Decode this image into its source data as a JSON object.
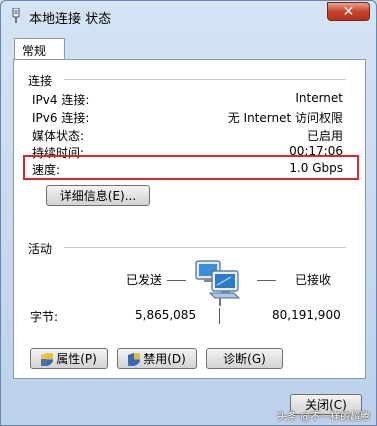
{
  "window": {
    "title": "本地连接 状态",
    "close_glyph": "✕"
  },
  "tabs": [
    {
      "label": "常规"
    }
  ],
  "connection": {
    "heading": "连接",
    "rows": [
      {
        "label": "IPv4 连接:",
        "value": "Internet"
      },
      {
        "label": "IPv6 连接:",
        "value": "无 Internet 访问权限"
      },
      {
        "label": "媒体状态:",
        "value": "已启用"
      },
      {
        "label": "持续时间:",
        "value": "00:17:06"
      },
      {
        "label": "速度:",
        "value": "1.0 Gbps"
      }
    ],
    "details_button": "详细信息(E)..."
  },
  "activity": {
    "heading": "活动",
    "sent_label": "已发送",
    "received_label": "已接收",
    "bytes_label": "字节:",
    "bytes_sent": "5,865,085",
    "bytes_received": "80,191,900"
  },
  "buttons": {
    "properties": "属性(P)",
    "disable": "禁用(D)",
    "diagnose": "诊断(G)",
    "close": "关闭(C)"
  },
  "watermark": "头条 @不一样的超腾",
  "colors": {
    "highlight_border": "#d42c2c",
    "titlebar": "#c6d8ec",
    "close_button": "#c7432a"
  }
}
